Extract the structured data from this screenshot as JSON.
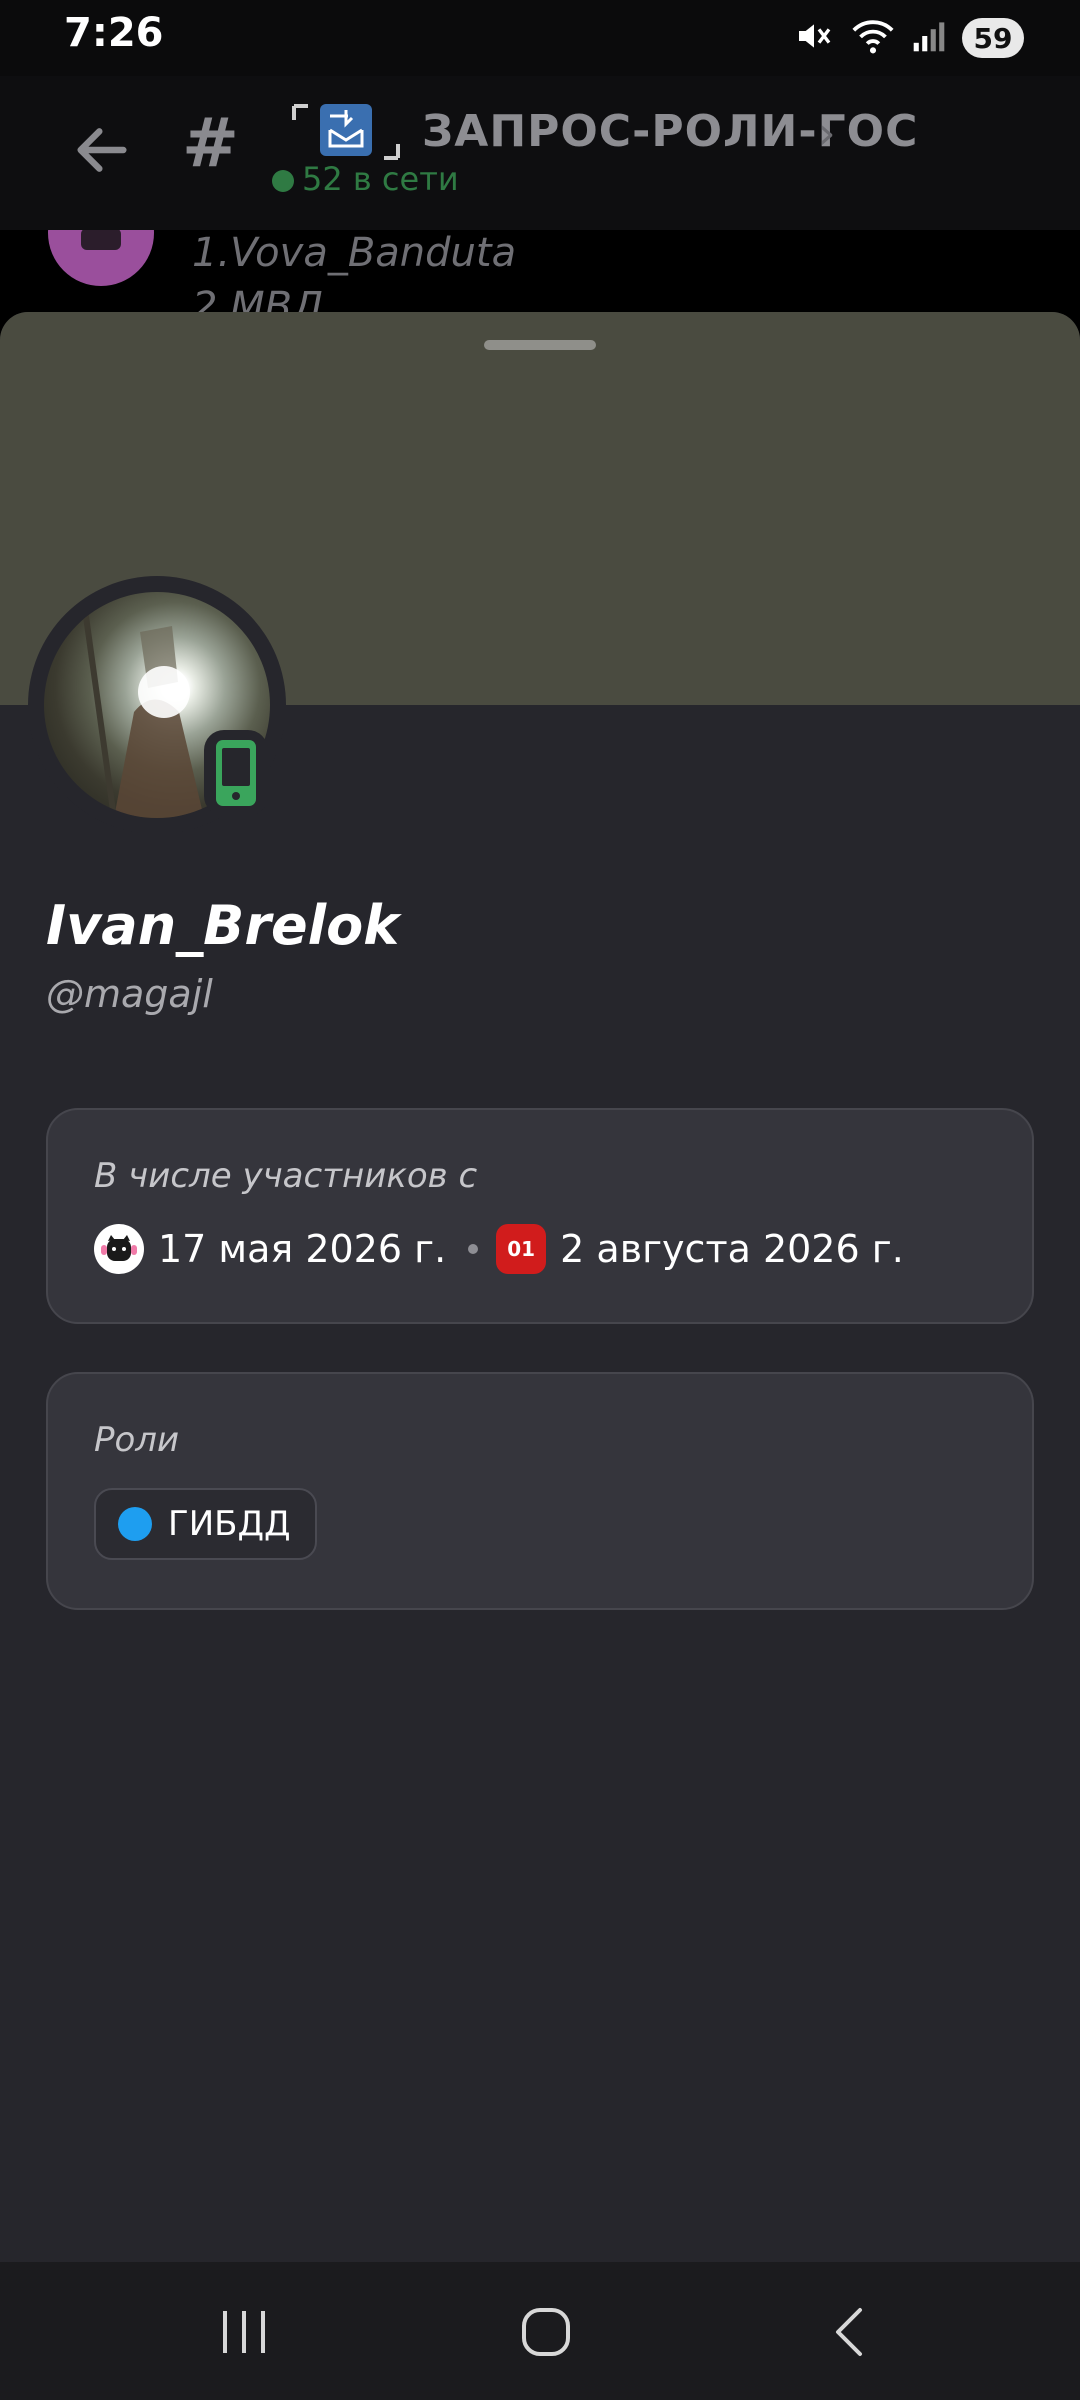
{
  "status_bar": {
    "time": "7:26",
    "battery": "59",
    "icons": [
      "mute-icon",
      "wifi-icon",
      "signal-icon",
      "battery-icon"
    ]
  },
  "channel": {
    "title": "ЗАПРОС-РОЛИ-ГОС",
    "online": "52 в сети",
    "online_color": "#2f7a43"
  },
  "chat_peek": {
    "line1": "1.Vova_Banduta",
    "line2": "2.МВД"
  },
  "profile": {
    "display_name": "Ivan_Brelok",
    "username": "@magajl",
    "banner_color": "#4a4b40",
    "members_card": {
      "title": "В числе участников с",
      "entries": [
        {
          "icon": "server-cat-icon",
          "date": "17 мая 2026 г."
        },
        {
          "icon": "server-01-icon",
          "icon_text": "01",
          "date": "2 августа 2026 г."
        }
      ]
    },
    "roles_card": {
      "title": "Роли",
      "roles": [
        {
          "name": "ГИБДД",
          "color": "#1e9ef0"
        }
      ]
    }
  }
}
